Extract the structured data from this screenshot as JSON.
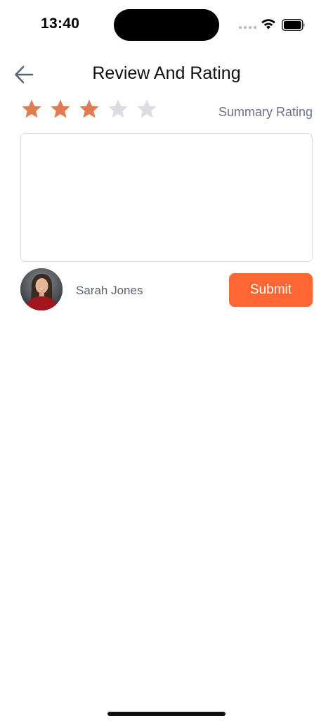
{
  "status_bar": {
    "time": "13:40"
  },
  "header": {
    "title": "Review And Rating",
    "back_icon": "arrow-left-icon"
  },
  "rating": {
    "value": 3,
    "max": 5,
    "summary_label": "Summary Rating",
    "filled_color": "#e07b52",
    "empty_color": "#dcdde2"
  },
  "review": {
    "value": "",
    "placeholder": ""
  },
  "author": {
    "name": "Sarah Jones"
  },
  "actions": {
    "submit_label": "Submit",
    "submit_color": "#ff6633"
  }
}
